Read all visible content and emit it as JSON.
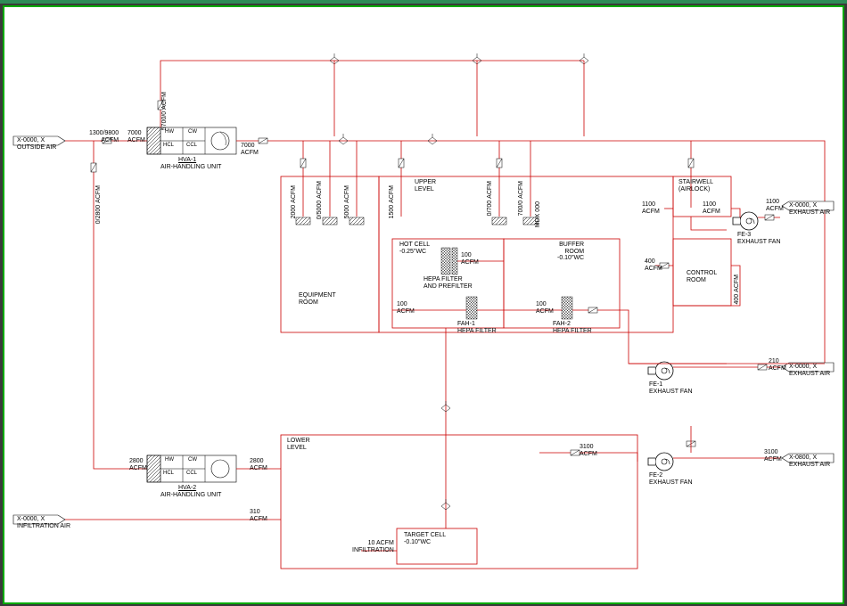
{
  "diagram_type": "HVAC Airflow Diagram",
  "inputs": {
    "outside_air": {
      "tag": "X-0000, X",
      "label": "OUTSIDE AIR"
    },
    "infiltration_air": {
      "tag": "X-0000, X",
      "label": "INFILTRATION AIR"
    }
  },
  "outputs": {
    "exhaust_1": {
      "tag": "X-0000, X",
      "label": "EXHAUST AIR",
      "flow": "1100",
      "unit": "ACFM"
    },
    "exhaust_2": {
      "tag": "X-0000, X",
      "label": "EXHAUST AIR",
      "flow": "210",
      "unit": "ACFM"
    },
    "exhaust_3": {
      "tag": "X-0800, X",
      "label": "EXHAUST AIR",
      "flow": "3100",
      "unit": "ACFM"
    }
  },
  "units": {
    "hva1": {
      "tag": "HVA-1",
      "label": "AIR-HANDLING UNIT",
      "components": [
        "HW",
        "CW",
        "HCL",
        "CCL"
      ]
    },
    "hva2": {
      "tag": "HVA-2",
      "label": "AIR-HANDLING UNIT",
      "components": [
        "HW",
        "CW",
        "HCL",
        "CCL"
      ]
    },
    "fe1": {
      "tag": "FE-1",
      "label": "EXHAUST FAN"
    },
    "fe2": {
      "tag": "FE-2",
      "label": "EXHAUST FAN"
    },
    "fe3": {
      "tag": "FE-3",
      "label": "EXHAUST FAN"
    },
    "fah1": {
      "tag": "FAH-1",
      "label": "HEPA FILTER"
    },
    "fah2": {
      "tag": "FAH-2",
      "label": "HEPA FILTER"
    },
    "hepa_pre": {
      "label1": "HEPA FILTER",
      "label2": "AND PREFILTER"
    }
  },
  "rooms": {
    "equipment": {
      "label": "EQUIPMENT",
      "sub": "ROOM"
    },
    "upper": {
      "label": "UPPER",
      "sub": "LEVEL"
    },
    "lower": {
      "label": "LOWER",
      "sub": "LEVEL"
    },
    "hot_cell": {
      "label": "HOT CELL",
      "pressure": "-0.25\"WC"
    },
    "buffer": {
      "label": "BUFFER",
      "sub": "ROOM",
      "pressure": "-0.10\"WC"
    },
    "control": {
      "label": "CONTROL",
      "sub": "ROOM"
    },
    "stairwell": {
      "label": "STAIRWELL",
      "sub": "(AIRLOCK)"
    },
    "target_cell": {
      "label": "TARGET CELL",
      "pressure": "-0.10\"WC"
    }
  },
  "flows": {
    "main_in": {
      "v": "1300/9800",
      "u": "ACFM"
    },
    "hva1_in": {
      "v": "7000",
      "u": "ACFM"
    },
    "hva1_top": {
      "v": "5700/0",
      "u": "ACFM"
    },
    "hva1_out": {
      "v": "7000",
      "u": "ACFM"
    },
    "bypass": {
      "v": "0/2800",
      "u": "ACFM"
    },
    "hva2_in": {
      "v": "2800",
      "u": "ACFM"
    },
    "hva2_out": {
      "v": "2800",
      "u": "ACFM"
    },
    "infil": {
      "v": "310",
      "u": "ACFM"
    },
    "infil_small": {
      "v": "10 ACFM",
      "u": "INFILTRATION"
    },
    "eq1": {
      "v": "2000",
      "u": "ACFM"
    },
    "eq2": {
      "v": "0/5000",
      "u": "ACFM"
    },
    "eq3": {
      "v": "5000",
      "u": "ACFM"
    },
    "up1": {
      "v": "1500",
      "u": "ACFM"
    },
    "up2": {
      "v": "0/700",
      "u": "ACFM"
    },
    "up3": {
      "v": "700/0",
      "u": "ACFM"
    },
    "up_mdx": {
      "v": "MDX",
      "u": "000"
    },
    "stair_in": {
      "v": "1100",
      "u": "ACFM"
    },
    "stair_out": {
      "v": "1100",
      "u": "ACFM"
    },
    "hc_100a": {
      "v": "100",
      "u": "ACFM"
    },
    "hc_100b": {
      "v": "100",
      "u": "ACFM"
    },
    "hc_100c": {
      "v": "100",
      "u": "ACFM"
    },
    "buf_400": {
      "v": "400",
      "u": "ACFM"
    },
    "ctrl_400": {
      "v": "400",
      "u": "ACFM"
    },
    "fe2_in": {
      "v": "3100",
      "u": "ACFM"
    }
  }
}
